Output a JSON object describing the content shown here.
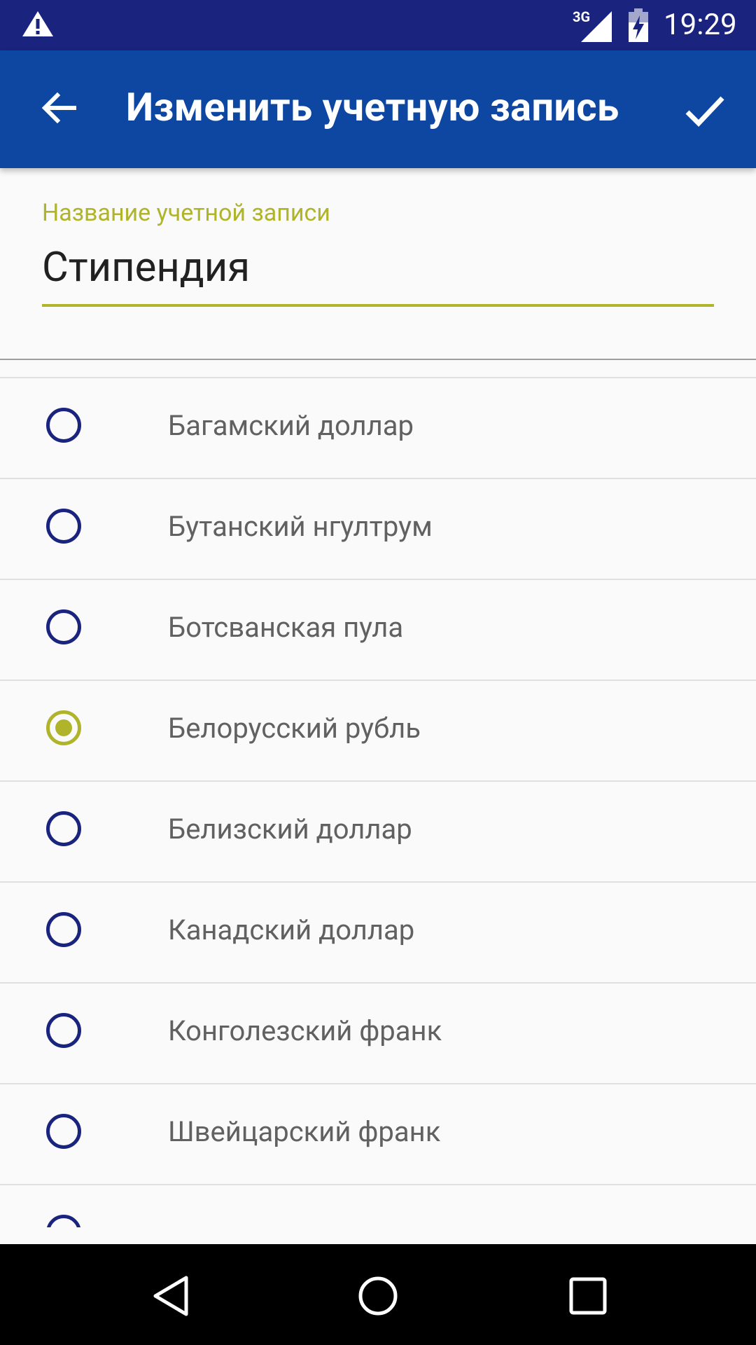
{
  "status_bar": {
    "network": "3G",
    "time": "19:29",
    "icons": [
      "warning-icon",
      "signal-icon",
      "battery-charging-icon"
    ]
  },
  "app_bar": {
    "title": "Изменить учетную запись",
    "icons": [
      "back-arrow-icon",
      "check-icon"
    ]
  },
  "account_name": {
    "label": "Название учетной записи",
    "value": "Стипендия",
    "accent_color": "#afb42b"
  },
  "currencies": [
    {
      "label": "Багамский доллар",
      "selected": false
    },
    {
      "label": "Бутанский нгултрум",
      "selected": false
    },
    {
      "label": "Ботсванская пула",
      "selected": false
    },
    {
      "label": "Белорусский рубль",
      "selected": true
    },
    {
      "label": "Белизский доллар",
      "selected": false
    },
    {
      "label": "Канадский доллар",
      "selected": false
    },
    {
      "label": "Конголезский франк",
      "selected": false
    },
    {
      "label": "Швейцарский франк",
      "selected": false
    }
  ],
  "colors": {
    "status_bar": "#1a237e",
    "app_bar": "#0d47a1",
    "radio_unselected": "#1a237e",
    "radio_selected": "#afb42b"
  },
  "nav_bar": {
    "icons": [
      "nav-back-icon",
      "nav-home-icon",
      "nav-recents-icon"
    ]
  }
}
